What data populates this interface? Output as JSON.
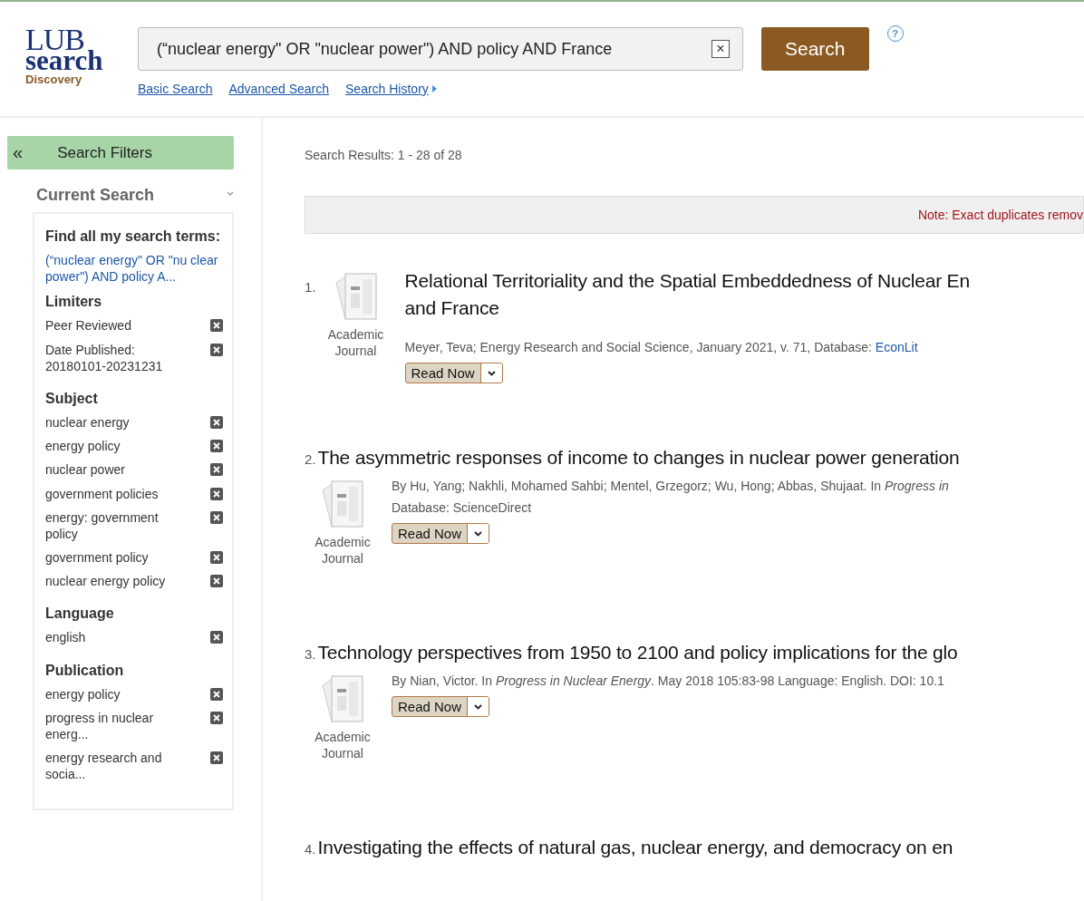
{
  "logo": {
    "line_1": "LUB",
    "line_2": "search",
    "line_3": "Discovery"
  },
  "search": {
    "value": "(“nuclear energy\" OR \"nuclear power\") AND policy AND France",
    "clear": "×",
    "button": "Search",
    "help": "?"
  },
  "search_links": [
    {
      "label": "Basic Search"
    },
    {
      "label": "Advanced Search"
    },
    {
      "label": "Search History",
      "arrow": true
    }
  ],
  "filters": {
    "collapse": "«",
    "title": "Search Filters",
    "current_search": "Current Search",
    "terms_heading": "Find all my search terms:",
    "terms_link": "(“nuclear energy\" OR \"nu clear power\") AND policy A...",
    "sections": [
      {
        "heading": "Limiters",
        "items": [
          "Peer Reviewed",
          "Date Published: 20180101-20231231"
        ]
      },
      {
        "heading": "Subject",
        "items": [
          "nuclear energy",
          "energy policy",
          "nuclear power",
          "government policies",
          "energy: government policy",
          "government policy",
          "nuclear energy policy"
        ]
      },
      {
        "heading": "Language",
        "items": [
          "english"
        ]
      },
      {
        "heading": "Publication",
        "items": [
          "energy policy",
          "progress in nuclear energ...",
          "energy research and socia..."
        ]
      }
    ]
  },
  "results_count": "Search Results: 1 - 28 of 28",
  "note": "Note: Exact duplicates remov",
  "results": [
    {
      "kind": "beside",
      "number": "1.",
      "title": "Relational Territoriality and the Spatial Embeddedness of Nuclear En",
      "title_2": "and France",
      "type": "Academic Journal",
      "meta": [
        "Meyer, Teva; Energy Research and Social Science, January 2021, v. 71, Database: "
      ],
      "database_link": "EconLit",
      "read_now": "Read Now"
    },
    {
      "kind": "above",
      "number": "2.",
      "title": "The asymmetric responses of income to changes in nuclear power generation",
      "type": "Academic Journal",
      "meta": [
        "By Hu, Yang; Nakhli, Mohamed Sahbi; Mentel, Grzegorz; Wu, Hong; Abbas, Shujaat. In *Progress in*",
        "Database: ScienceDirect"
      ],
      "read_now": "Read Now"
    },
    {
      "kind": "above",
      "number": "3.",
      "title": "Technology perspectives from 1950 to 2100 and policy implications for the glo",
      "type": "Academic Journal",
      "meta": [
        "By Nian, Victor. In *Progress in Nuclear Energy*. May 2018 105:83-98 Language: English. DOI: 10.1"
      ],
      "read_now": "Read Now"
    },
    {
      "kind": "above",
      "number": "4.",
      "title": "Investigating the effects of natural gas, nuclear energy, and democracy on en"
    }
  ]
}
